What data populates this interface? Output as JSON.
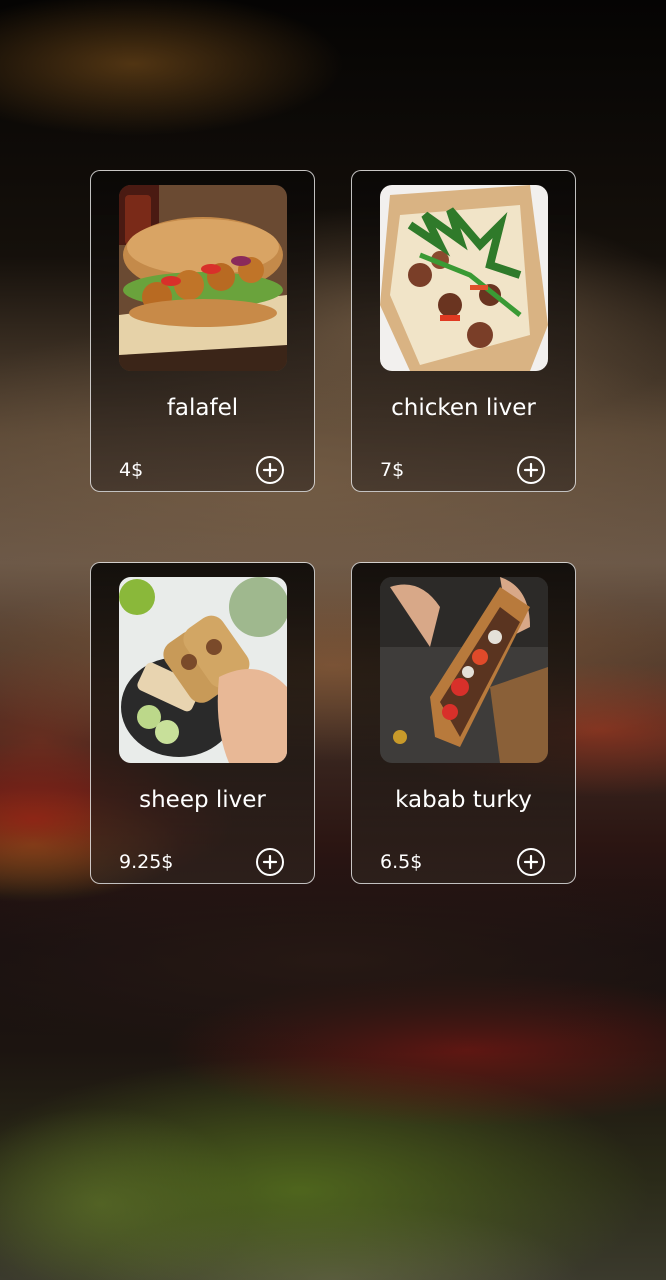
{
  "menu": {
    "items": [
      {
        "name": "falafel",
        "price": "4$"
      },
      {
        "name": "chicken liver",
        "price": "7$"
      },
      {
        "name": "sheep liver",
        "price": "9.25$"
      },
      {
        "name": "kabab turky",
        "price": "6.5$"
      }
    ],
    "add_icon": "plus-circle-icon"
  }
}
